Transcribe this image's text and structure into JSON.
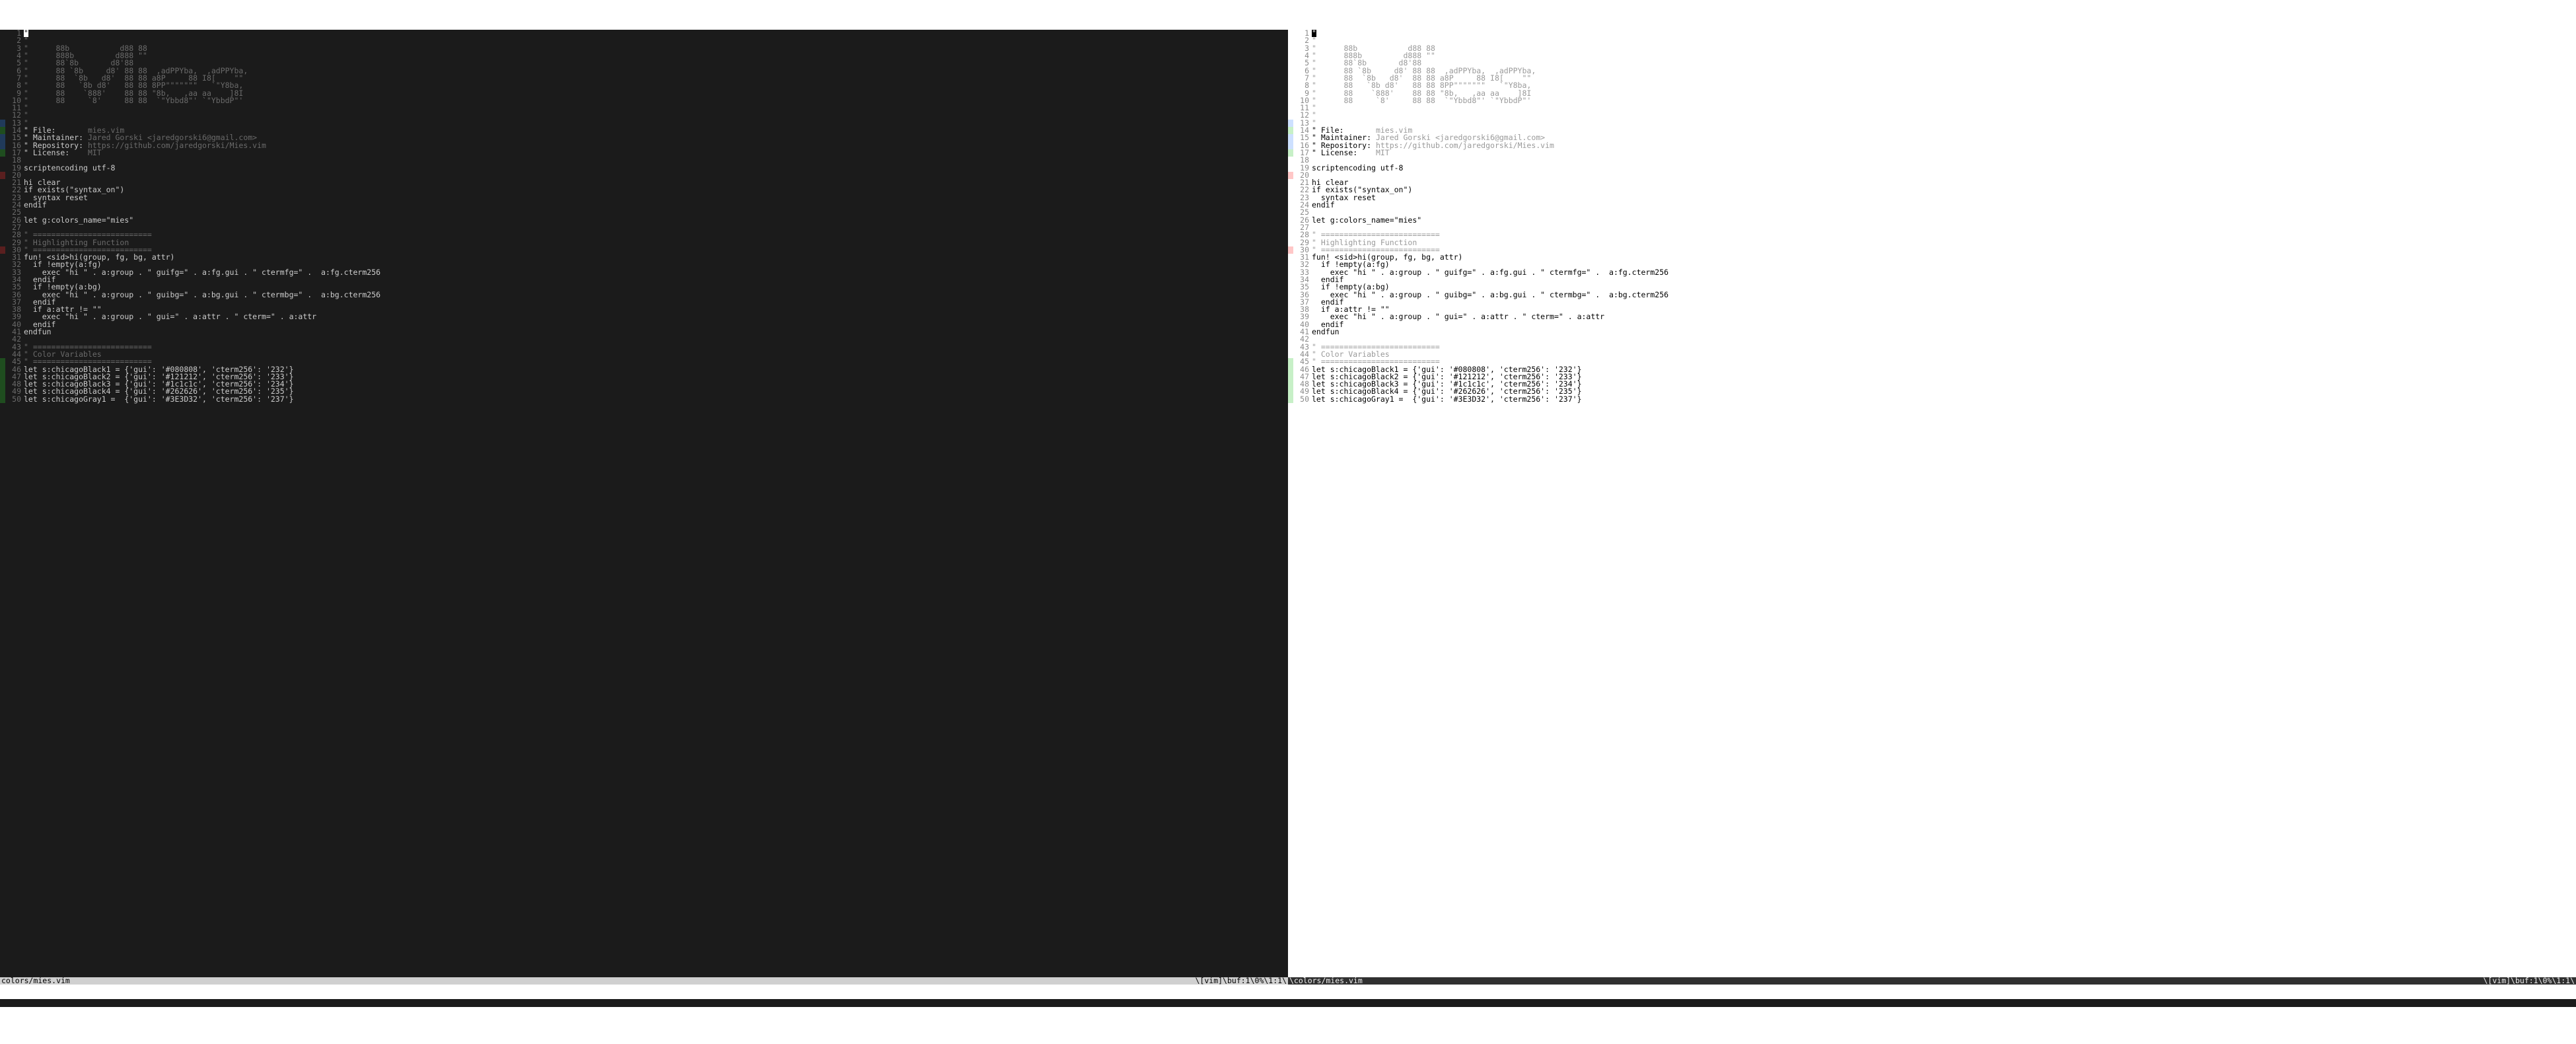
{
  "cmdline": " ",
  "status": {
    "left_file": "colors/mies.vim",
    "left_right": "\\[vim]\\buf:1\\0%\\1:1\\",
    "right_file": "\\colors/mies.vim",
    "right_right": "\\[vim]\\buf:1\\0%\\1:1\\"
  },
  "lines": [
    {
      "n": 1,
      "sign": "",
      "cls": "comment",
      "t": "\"",
      "cursor": true
    },
    {
      "n": 2,
      "sign": "",
      "cls": "comment",
      "t": "\""
    },
    {
      "n": 3,
      "sign": "",
      "cls": "comment",
      "t": "\"      88b           d88 88"
    },
    {
      "n": 4,
      "sign": "",
      "cls": "comment",
      "t": "\"      888b         d888 \"\""
    },
    {
      "n": 5,
      "sign": "",
      "cls": "comment",
      "t": "\"      88`8b       d8'88"
    },
    {
      "n": 6,
      "sign": "",
      "cls": "comment",
      "t": "\"      88 `8b     d8' 88 88  ,adPPYba,  ,adPPYba,"
    },
    {
      "n": 7,
      "sign": "",
      "cls": "comment",
      "t": "\"      88  `8b   d8'  88 88 a8P     88 I8[    \"\""
    },
    {
      "n": 8,
      "sign": "",
      "cls": "comment",
      "t": "\"      88   `8b d8'   88 88 8PP\"\"\"\"\"\"\"   `\"Y8ba,"
    },
    {
      "n": 9,
      "sign": "",
      "cls": "comment",
      "t": "\"      88    `888'    88 88 \"8b,   ,aa aa    ]8I"
    },
    {
      "n": 10,
      "sign": "",
      "cls": "comment",
      "t": "\"      88     `8'     88 88  `\"Ybbd8\"' `\"YbbdP\"'"
    },
    {
      "n": 11,
      "sign": "",
      "cls": "comment",
      "t": "\""
    },
    {
      "n": 12,
      "sign": "",
      "cls": "comment",
      "t": "\""
    },
    {
      "n": 13,
      "sign": "mod",
      "cls": "comment",
      "t": "\""
    },
    {
      "n": 14,
      "sign": "add",
      "cls": "",
      "t": "\" File:       ",
      "tail": "mies.vim"
    },
    {
      "n": 15,
      "sign": "mod",
      "cls": "",
      "t": "\" Maintainer: ",
      "tail": "Jared Gorski <jaredgorski6@gmail.com>"
    },
    {
      "n": 16,
      "sign": "mod",
      "cls": "",
      "t": "\" Repository: ",
      "tail": "https://github.com/jaredgorski/Mies.vim"
    },
    {
      "n": 17,
      "sign": "add",
      "cls": "",
      "t": "\" License:    ",
      "tail": "MIT"
    },
    {
      "n": 18,
      "sign": "",
      "cls": "",
      "t": ""
    },
    {
      "n": 19,
      "sign": "",
      "cls": "",
      "t": "scriptencoding utf-8"
    },
    {
      "n": 20,
      "sign": "del",
      "cls": "",
      "t": ""
    },
    {
      "n": 21,
      "sign": "",
      "cls": "",
      "t": "hi clear"
    },
    {
      "n": 22,
      "sign": "",
      "cls": "",
      "t": "if exists(\"syntax_on\")"
    },
    {
      "n": 23,
      "sign": "",
      "cls": "",
      "t": "  syntax reset"
    },
    {
      "n": 24,
      "sign": "",
      "cls": "",
      "t": "endif"
    },
    {
      "n": 25,
      "sign": "",
      "cls": "",
      "t": ""
    },
    {
      "n": 26,
      "sign": "",
      "cls": "",
      "t": "let g:colors_name=\"mies\""
    },
    {
      "n": 27,
      "sign": "",
      "cls": "",
      "t": ""
    },
    {
      "n": 28,
      "sign": "",
      "cls": "comment",
      "t": "\" =========================="
    },
    {
      "n": 29,
      "sign": "",
      "cls": "comment",
      "t": "\" Highlighting Function"
    },
    {
      "n": 30,
      "sign": "del",
      "cls": "comment",
      "t": "\" =========================="
    },
    {
      "n": 31,
      "sign": "",
      "cls": "",
      "t": "fun! <sid>hi(group, fg, bg, attr)"
    },
    {
      "n": 32,
      "sign": "",
      "cls": "",
      "t": "  if !empty(a:fg)"
    },
    {
      "n": 33,
      "sign": "",
      "cls": "",
      "t": "    exec \"hi \" . a:group . \" guifg=\" . a:fg.gui . \" ctermfg=\" .  a:fg.cterm256"
    },
    {
      "n": 34,
      "sign": "",
      "cls": "",
      "t": "  endif"
    },
    {
      "n": 35,
      "sign": "",
      "cls": "",
      "t": "  if !empty(a:bg)"
    },
    {
      "n": 36,
      "sign": "",
      "cls": "",
      "t": "    exec \"hi \" . a:group . \" guibg=\" . a:bg.gui . \" ctermbg=\" .  a:bg.cterm256"
    },
    {
      "n": 37,
      "sign": "",
      "cls": "",
      "t": "  endif"
    },
    {
      "n": 38,
      "sign": "",
      "cls": "",
      "t": "  if a:attr != \"\""
    },
    {
      "n": 39,
      "sign": "",
      "cls": "",
      "t": "    exec \"hi \" . a:group . \" gui=\" . a:attr . \" cterm=\" . a:attr"
    },
    {
      "n": 40,
      "sign": "",
      "cls": "",
      "t": "  endif"
    },
    {
      "n": 41,
      "sign": "",
      "cls": "",
      "t": "endfun"
    },
    {
      "n": 42,
      "sign": "",
      "cls": "",
      "t": ""
    },
    {
      "n": 43,
      "sign": "",
      "cls": "comment",
      "t": "\" =========================="
    },
    {
      "n": 44,
      "sign": "",
      "cls": "comment",
      "t": "\" Color Variables"
    },
    {
      "n": 45,
      "sign": "add",
      "cls": "comment",
      "t": "\" =========================="
    },
    {
      "n": 46,
      "sign": "add",
      "cls": "",
      "t": "let s:chicagoBlack1 = {'gui': '#080808', 'cterm256': '232'}"
    },
    {
      "n": 47,
      "sign": "add",
      "cls": "",
      "t": "let s:chicagoBlack2 = {'gui': '#121212', 'cterm256': '233'}"
    },
    {
      "n": 48,
      "sign": "add",
      "cls": "",
      "t": "let s:chicagoBlack3 = {'gui': '#1c1c1c', 'cterm256': '234'}"
    },
    {
      "n": 49,
      "sign": "add",
      "cls": "",
      "t": "let s:chicagoBlack4 = {'gui': '#262626', 'cterm256': '235'}"
    },
    {
      "n": 50,
      "sign": "add",
      "cls": "",
      "t": "let s:chicagoGray1 =  {'gui': '#3E3D32', 'cterm256': '237'}"
    }
  ]
}
